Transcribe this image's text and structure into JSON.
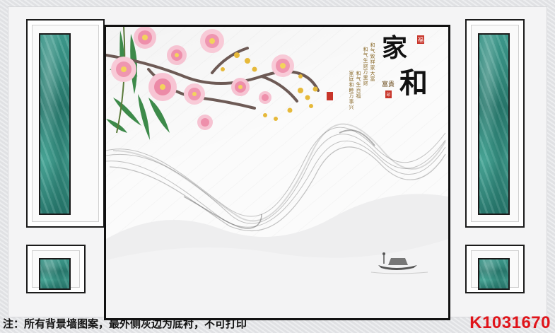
{
  "calligraphy": {
    "title_chars": [
      "家",
      "和"
    ],
    "subtitle": "富貴",
    "poem_lines": [
      "和气致祥家大富",
      "和气生财万里财",
      "和气生百福",
      "家庭和睦万事兴"
    ],
    "seal_top": "福",
    "seal_bottom": "印"
  },
  "footer": {
    "caption": "注：所有背景墙图案，最外侧灰边为底衬，不可打印",
    "product_code": "K1031670"
  },
  "colors": {
    "marble": "#2f8a7d",
    "frame_line": "#1b1b1b",
    "blossom": "#f2a6bd",
    "code_red": "#e0141a"
  }
}
